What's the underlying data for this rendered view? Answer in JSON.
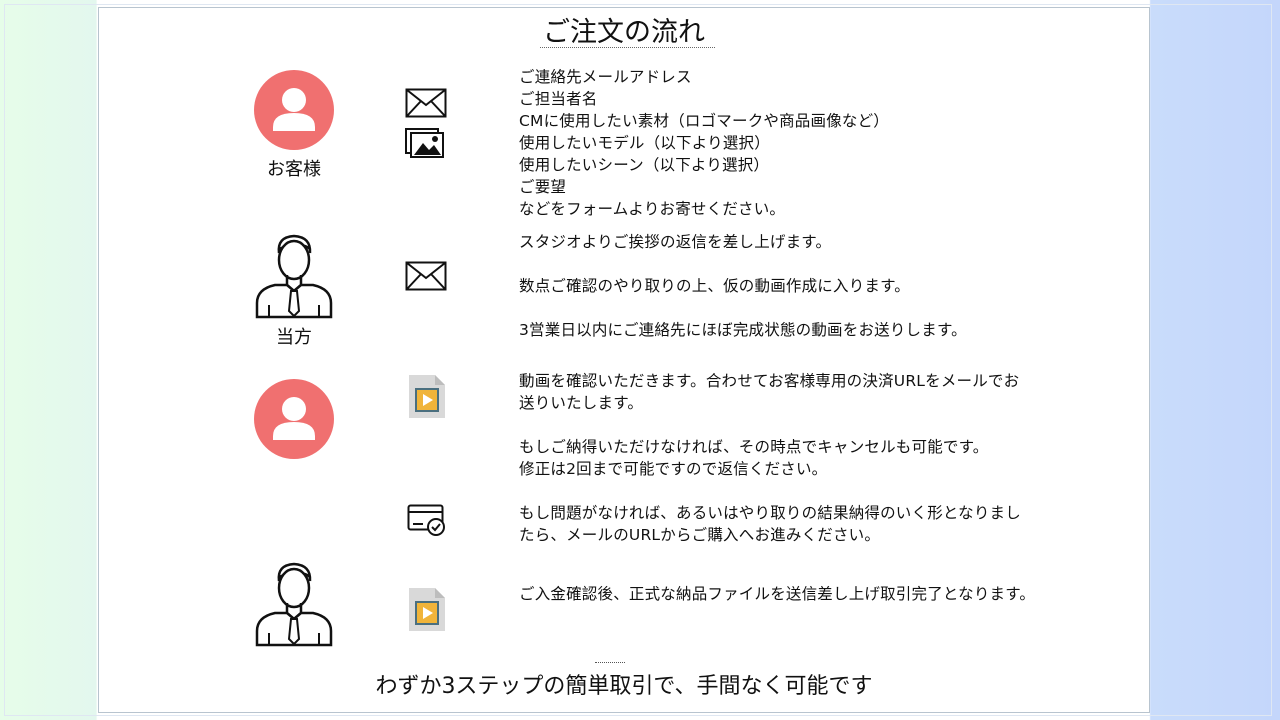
{
  "title": "ご注文の流れ",
  "steps": [
    {
      "actor": "お客様",
      "actor_icon": "customer-avatar-icon",
      "icons": [
        "envelope-icon",
        "image-gallery-icon"
      ],
      "lines": [
        "ご連絡先メールアドレス",
        "ご担当者名",
        "CMに使用したい素材（ロゴマークや商品画像など）",
        "使用したいモデル（以下より選択）",
        "使用したいシーン（以下より選択）",
        "ご要望",
        "などをフォームよりお寄せください。"
      ]
    },
    {
      "actor": "当方",
      "actor_icon": "businessman-icon",
      "icons": [
        "envelope-icon"
      ],
      "lines": [
        "スタジオよりご挨拶の返信を差し上げます。",
        "",
        "数点ご確認のやり取りの上、仮の動画作成に入ります。",
        "",
        "3営業日以内にご連絡先にほぼ完成状態の動画をお送りします。"
      ]
    },
    {
      "actor": "",
      "actor_icon": "customer-avatar-icon",
      "icons": [
        "video-file-icon"
      ],
      "lines": [
        "動画を確認いただきます。合わせてお客様専用の決済URLをメールでお",
        "送りいたします。",
        "",
        "もしご納得いただけなければ、その時点でキャンセルも可能です。",
        "修正は2回まで可能ですので返信ください。"
      ]
    },
    {
      "actor": "",
      "actor_icon": "",
      "icons": [
        "payment-check-icon"
      ],
      "lines": [
        "もし問題がなければ、あるいはやり取りの結果納得のいく形となりまし",
        "たら、メールのURLからご購入へお進みください。"
      ]
    },
    {
      "actor": "",
      "actor_icon": "businessman-icon",
      "icons": [
        "video-file-icon"
      ],
      "lines": [
        "ご入金確認後、正式な納品ファイルを送信差し上げ取引完了となります。"
      ]
    }
  ],
  "footer": "わずか3ステップの簡単取引で、手間なく可能です",
  "colors": {
    "avatar": "#f07070",
    "left_bg": "#e6fde9",
    "right_bg": "#c4d6fb",
    "video_icon_frame": "#d9d9d9",
    "video_icon_screen": "#4a6f7f",
    "video_icon_play": "#f0b43a"
  }
}
